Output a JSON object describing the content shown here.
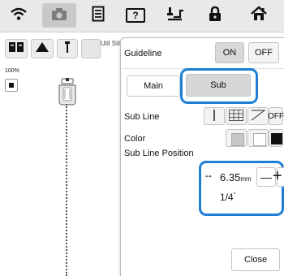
{
  "toolbar": {
    "icons": [
      "wifi-icon",
      "camera-icon",
      "document-icon",
      "help-icon",
      "needle-icon",
      "lock-icon",
      "home-icon"
    ],
    "help_label": "?"
  },
  "left": {
    "util_text": "Util Stit",
    "zoom": "100%"
  },
  "panel": {
    "guideline_label": "Guideline",
    "on_label": "ON",
    "off_label": "OFF",
    "tab_main": "Main",
    "tab_sub": "Sub",
    "sub_line_label": "Sub Line",
    "sub_line_off": "OFF",
    "color_label": "Color",
    "position_label": "Sub Line Position",
    "arrow": "↔",
    "value_mm": "6.35",
    "unit_mm": "mm",
    "value_inch": "1/4",
    "inch_mark": "\"",
    "minus": "—",
    "plus": "+",
    "close_label": "Close"
  },
  "colors": {
    "highlight": "#1f7fd6",
    "swatch_gray": "#c8c8c8",
    "swatch_white": "#ffffff",
    "swatch_black": "#111111"
  }
}
